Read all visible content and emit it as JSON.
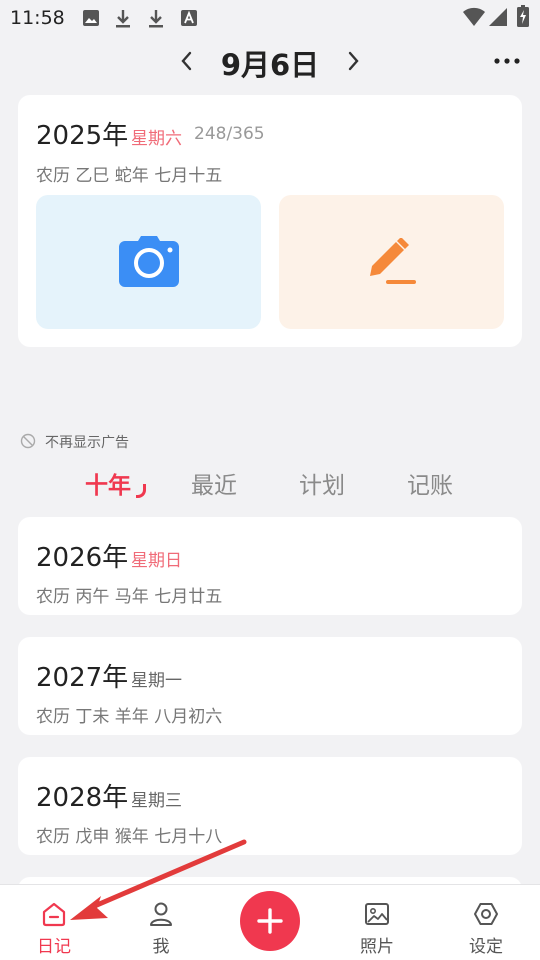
{
  "status_bar": {
    "time": "11:58",
    "left_icons": [
      "image-icon",
      "download-icon",
      "download-icon",
      "text-a-icon"
    ],
    "right_icons": [
      "wifi-icon",
      "signal-icon",
      "battery-charging-icon"
    ]
  },
  "header": {
    "date": "9月6日",
    "prev_icon": "chevron-left-icon",
    "next_icon": "chevron-right-icon",
    "more_icon": "more-dots-icon"
  },
  "today_card": {
    "year": "2025年",
    "weekday": "星期六",
    "day_count": "248/365",
    "lunar": "农历 乙巳 蛇年 七月十五",
    "photo_icon": "camera-icon",
    "write_icon": "pencil-icon",
    "colors": {
      "photo_bg": "#e5f3fb",
      "photo_icon": "#3b8ef5",
      "write_bg": "#fdf2e8",
      "write_icon": "#f5893a"
    }
  },
  "ad_note": {
    "icon": "no-entry-icon",
    "text": "不再显示广告"
  },
  "tabs": [
    {
      "label": "十年",
      "active": true
    },
    {
      "label": "最近",
      "active": false
    },
    {
      "label": "计划",
      "active": false
    },
    {
      "label": "记账",
      "active": false
    }
  ],
  "years": [
    {
      "year": "2026年",
      "weekday": "星期日",
      "lunar": "农历 丙午 马年 七月廿五",
      "weekend": true
    },
    {
      "year": "2027年",
      "weekday": "星期一",
      "lunar": "农历 丁未 羊年 八月初六",
      "weekend": false
    },
    {
      "year": "2028年",
      "weekday": "星期三",
      "lunar": "农历 戊申 猴年 七月十八",
      "weekend": false
    }
  ],
  "bottom_nav": [
    {
      "label": "日记",
      "icon": "diary-home-icon",
      "active": true
    },
    {
      "label": "我",
      "icon": "person-icon",
      "active": false
    },
    {
      "label": "",
      "icon": "plus-icon",
      "active": false
    },
    {
      "label": "照片",
      "icon": "photo-icon",
      "active": false
    },
    {
      "label": "设定",
      "icon": "settings-hexagon-icon",
      "active": false
    }
  ],
  "colors": {
    "accent": "#f0384f",
    "background": "#f2f2f4",
    "annotation_arrow": "#e23b3b"
  }
}
